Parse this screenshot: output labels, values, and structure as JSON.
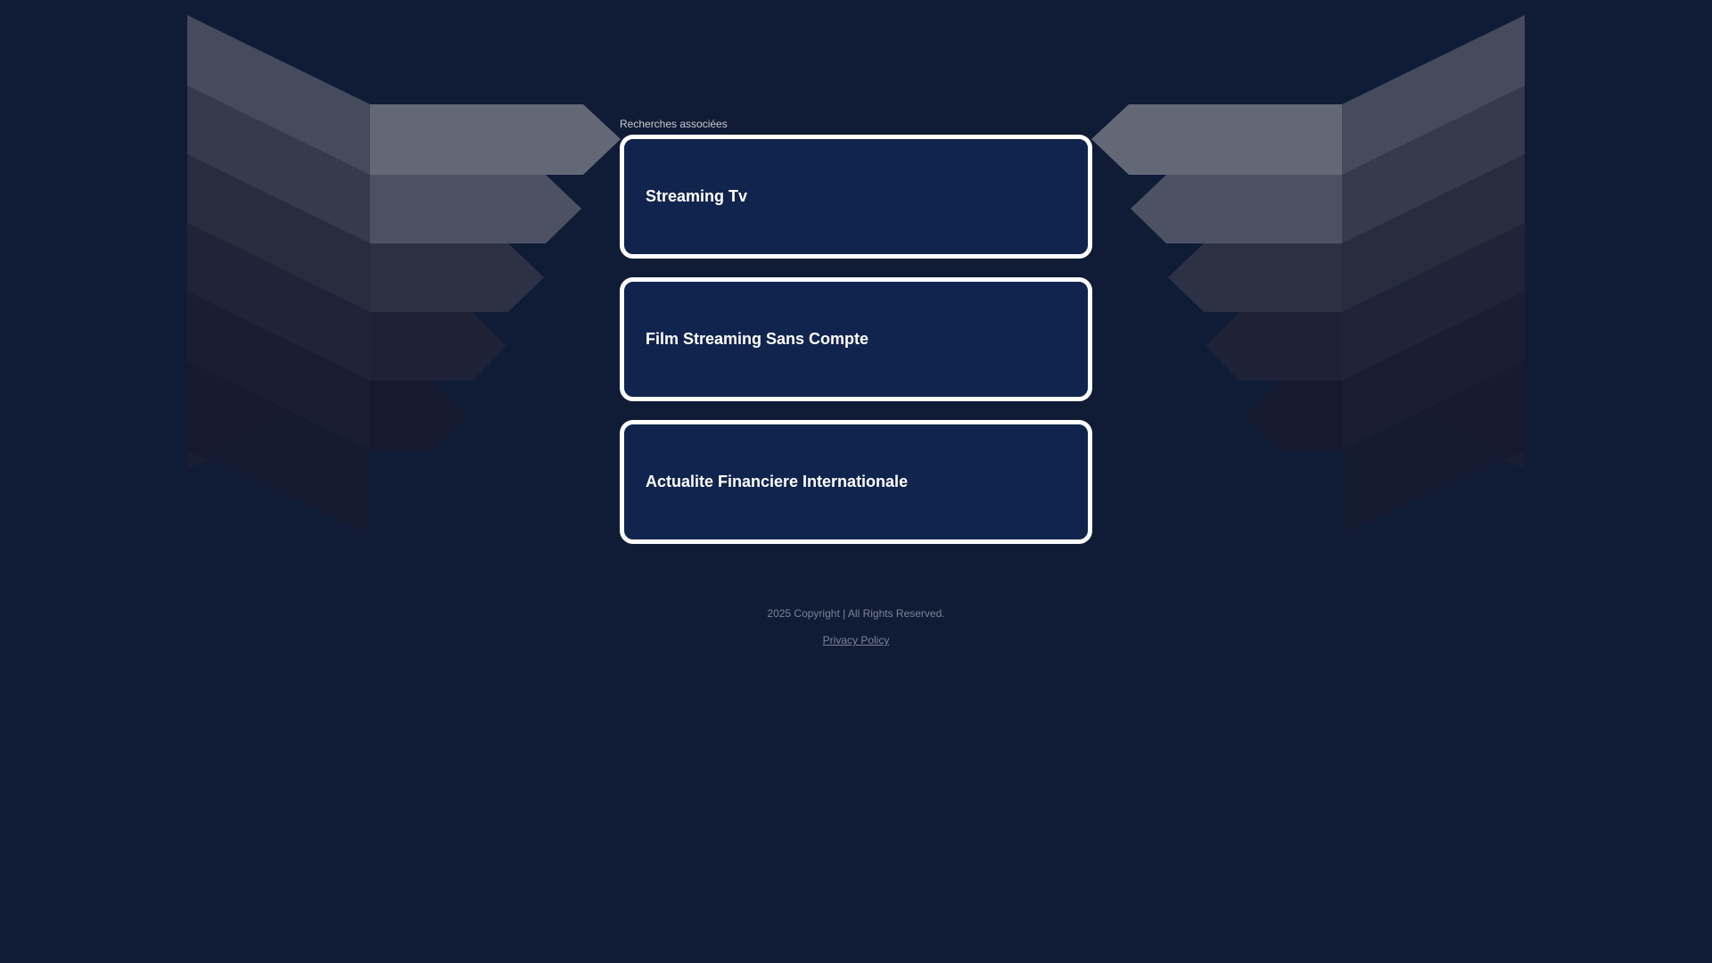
{
  "related": {
    "heading": "Recherches associées",
    "links": [
      {
        "label": "Streaming Tv"
      },
      {
        "label": "Film Streaming Sans Compte"
      },
      {
        "label": "Actualite Financiere Internationale"
      }
    ]
  },
  "footer": {
    "copyright": "2025 Copyright | All Rights Reserved.",
    "privacy_label": "Privacy Policy"
  },
  "colors": {
    "background": "#101c36",
    "card_fill": "#11244e",
    "card_border": "#ffffff"
  }
}
